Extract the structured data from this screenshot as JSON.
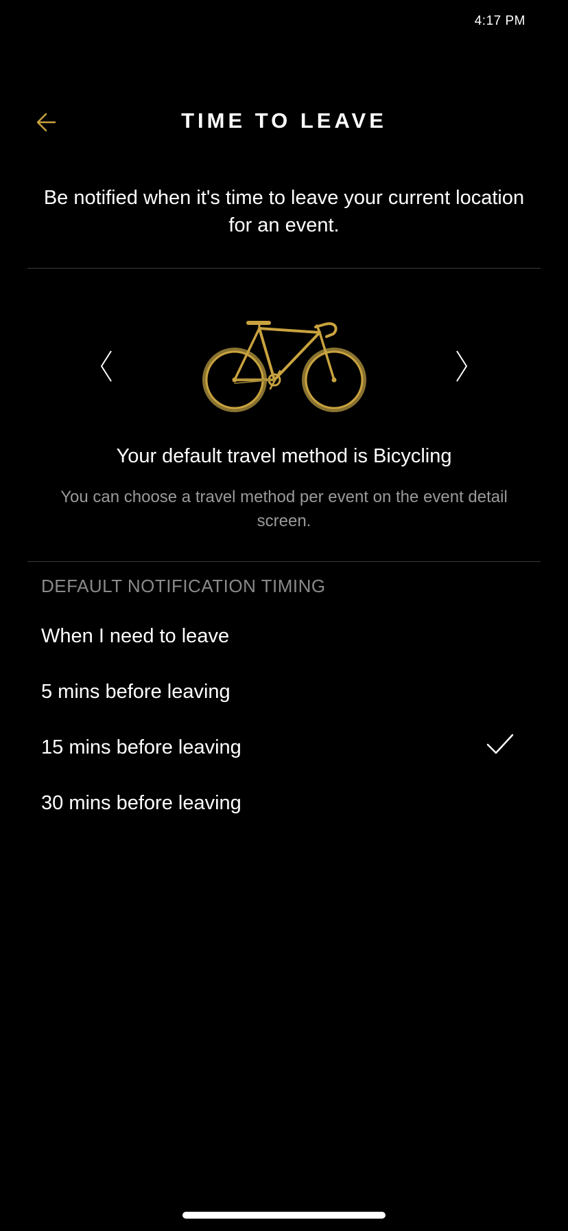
{
  "status_bar": {
    "time": "4:17 PM"
  },
  "header": {
    "title": "TIME TO LEAVE",
    "back_icon": "arrow-left-icon"
  },
  "intro": {
    "text": "Be notified when it's time to leave your current location for an event."
  },
  "travel": {
    "method_text": "Your default travel method is Bicycling",
    "hint": "You can choose a travel method per event on the event detail screen.",
    "illustration": "bicycle-icon",
    "prev_icon": "chevron-left-icon",
    "next_icon": "chevron-right-icon"
  },
  "timing": {
    "section_title": "DEFAULT NOTIFICATION TIMING",
    "options": [
      {
        "label": "When I need to leave",
        "selected": false
      },
      {
        "label": "5 mins before leaving",
        "selected": false
      },
      {
        "label": "15 mins before leaving",
        "selected": true
      },
      {
        "label": "30 mins before leaving",
        "selected": false
      }
    ]
  },
  "colors": {
    "background": "#000000",
    "accent": "#C9A33F",
    "text": "#FFFFFF",
    "muted_text": "#9A9A9A",
    "divider": "#3A3A3A"
  }
}
